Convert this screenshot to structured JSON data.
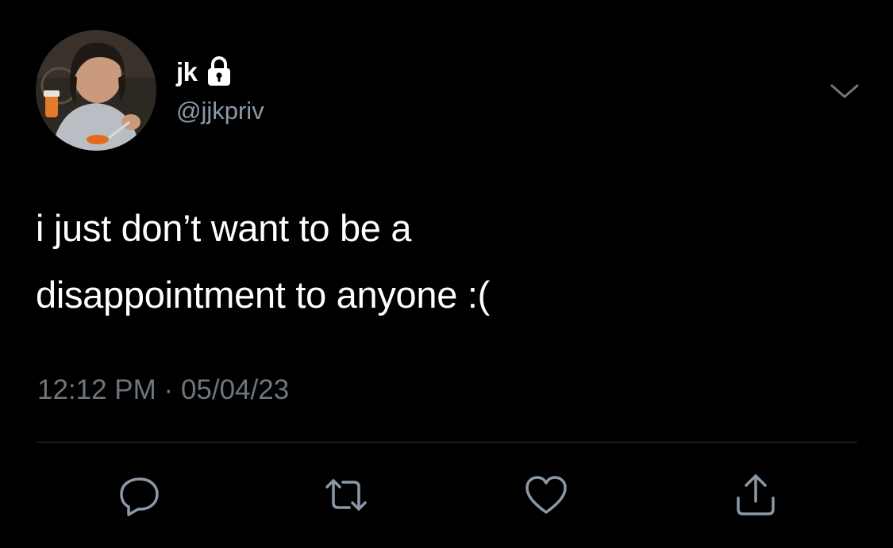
{
  "user": {
    "display_name": "jk",
    "handle": "@jjkpriv",
    "protected": true
  },
  "tweet": {
    "text_lines": [
      "i just don’t want to be a",
      "disappointment to anyone :("
    ],
    "time": "12:12 PM",
    "separator": "·",
    "date": "05/04/23"
  },
  "icons": {
    "lock": "lock-icon",
    "menu": "chevron-down-icon",
    "reply": "reply-icon",
    "retweet": "retweet-icon",
    "like": "heart-icon",
    "share": "share-icon"
  },
  "colors": {
    "background": "#000000",
    "text": "#ffffff",
    "secondary_text": "#8b98a5",
    "icon": "#8b98a5",
    "divider": "#2f3336"
  }
}
